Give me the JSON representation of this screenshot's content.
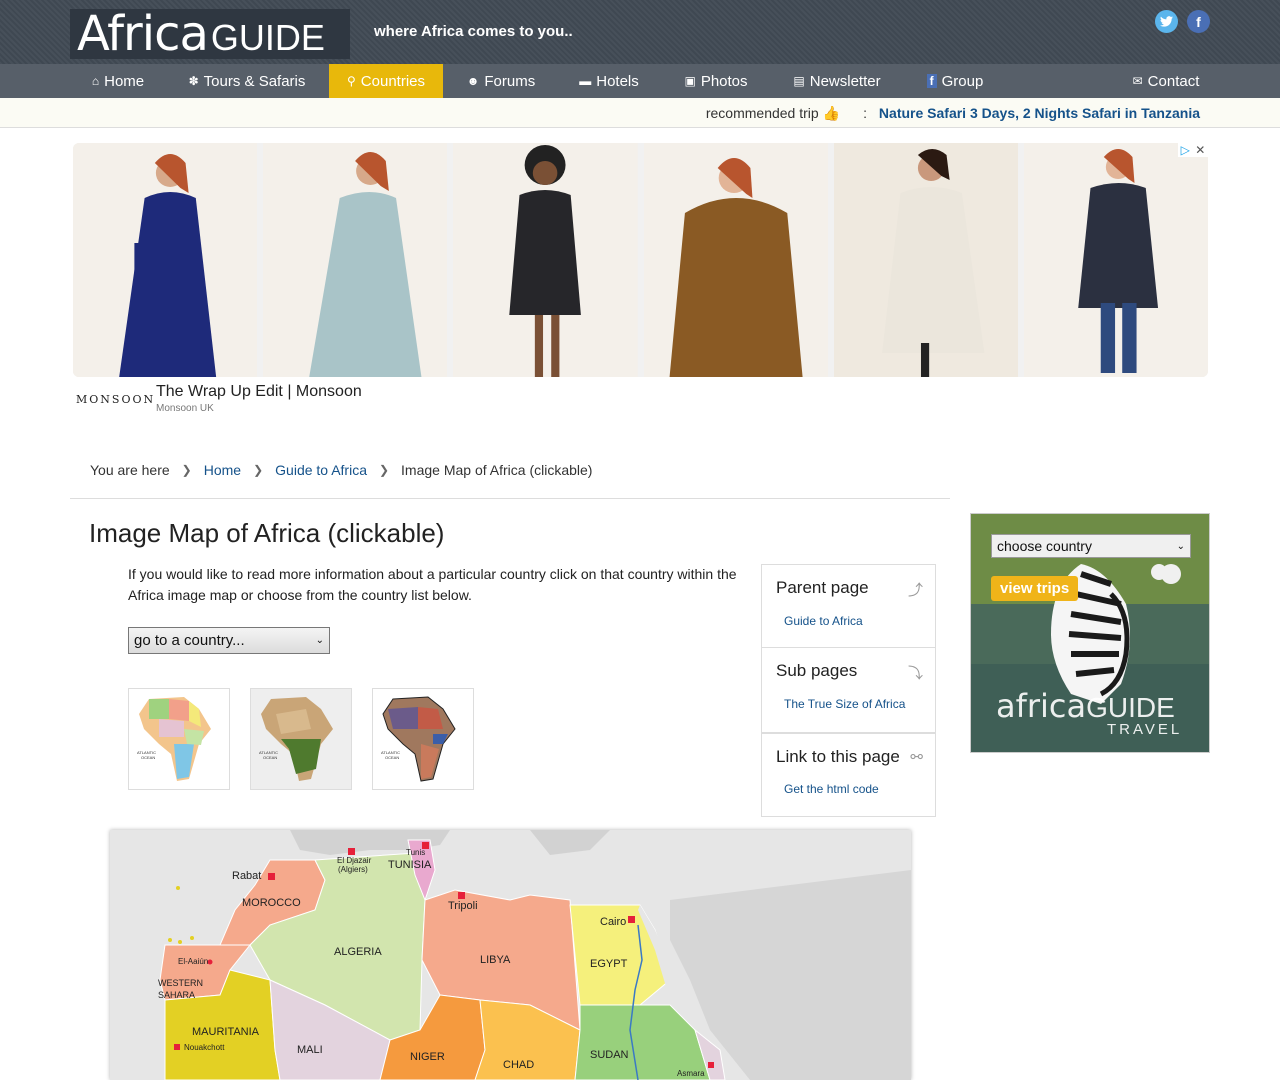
{
  "header": {
    "logo_africa": "Africa",
    "logo_guide": "GUIDE",
    "tagline": "where Africa comes to you..",
    "social": [
      "twitter-icon",
      "facebook-icon"
    ]
  },
  "nav": [
    {
      "label": "Home",
      "icon": "home-icon",
      "glyph": "⌂"
    },
    {
      "label": "Tours & Safaris",
      "icon": "paw-icon",
      "glyph": "✽"
    },
    {
      "label": "Countries",
      "icon": "map-pin-icon",
      "glyph": "⚲",
      "active": true
    },
    {
      "label": "Forums",
      "icon": "users-icon",
      "glyph": "☻"
    },
    {
      "label": "Hotels",
      "icon": "bed-icon",
      "glyph": "▬"
    },
    {
      "label": "Photos",
      "icon": "image-icon",
      "glyph": "▣"
    },
    {
      "label": "Newsletter",
      "icon": "newspaper-icon",
      "glyph": "▤"
    },
    {
      "label": "Group",
      "icon": "facebook-icon",
      "glyph": "f"
    },
    {
      "label": "Contact",
      "icon": "envelope-icon",
      "glyph": "✉"
    }
  ],
  "recommended": {
    "label": "recommended trip",
    "link": "Nature Safari 3 Days, 2 Nights Safari in Tanzania"
  },
  "ad": {
    "brand": "MONSOON",
    "title": "The Wrap Up Edit | Monsoon",
    "source": "Monsoon UK",
    "coat_colors": [
      "#1e2a7a",
      "#a9c4c8",
      "#26262a",
      "#8a5a24",
      "#ebe6dc",
      "#2b3040"
    ]
  },
  "breadcrumb": {
    "prefix": "You are here",
    "items": [
      "Home",
      "Guide to Africa",
      "Image Map of Africa (clickable)"
    ]
  },
  "main": {
    "title": "Image Map of Africa (clickable)",
    "intro": "If you would like to read more information about a particular country click on that country within the Africa image map or choose from the country list below.",
    "select_value": "go to a country..."
  },
  "sidebar": {
    "parent": {
      "title": "Parent page",
      "link": "Guide to Africa"
    },
    "sub": {
      "title": "Sub pages",
      "link": "The True Size of Africa"
    },
    "linkto": {
      "title": "Link to this page",
      "link": "Get the html code"
    }
  },
  "travel_ad": {
    "select_value": "choose country",
    "button": "view trips",
    "logo_africa": "africa",
    "logo_guide": "GUIDE",
    "logo_sub": "TRAVEL"
  },
  "map": {
    "labels": [
      "Rabat",
      "MOROCCO",
      "El Djazair",
      "(Algiers)",
      "Tunis",
      "TUNISIA",
      "Tripoli",
      "Cairo",
      "ALGERIA",
      "LIBYA",
      "EGYPT",
      "El-Aaiún",
      "WESTERN",
      "SAHARA",
      "MAURITANIA",
      "Nouakchott",
      "MALI",
      "NIGER",
      "CHAD",
      "SUDAN",
      "Asmara"
    ]
  }
}
